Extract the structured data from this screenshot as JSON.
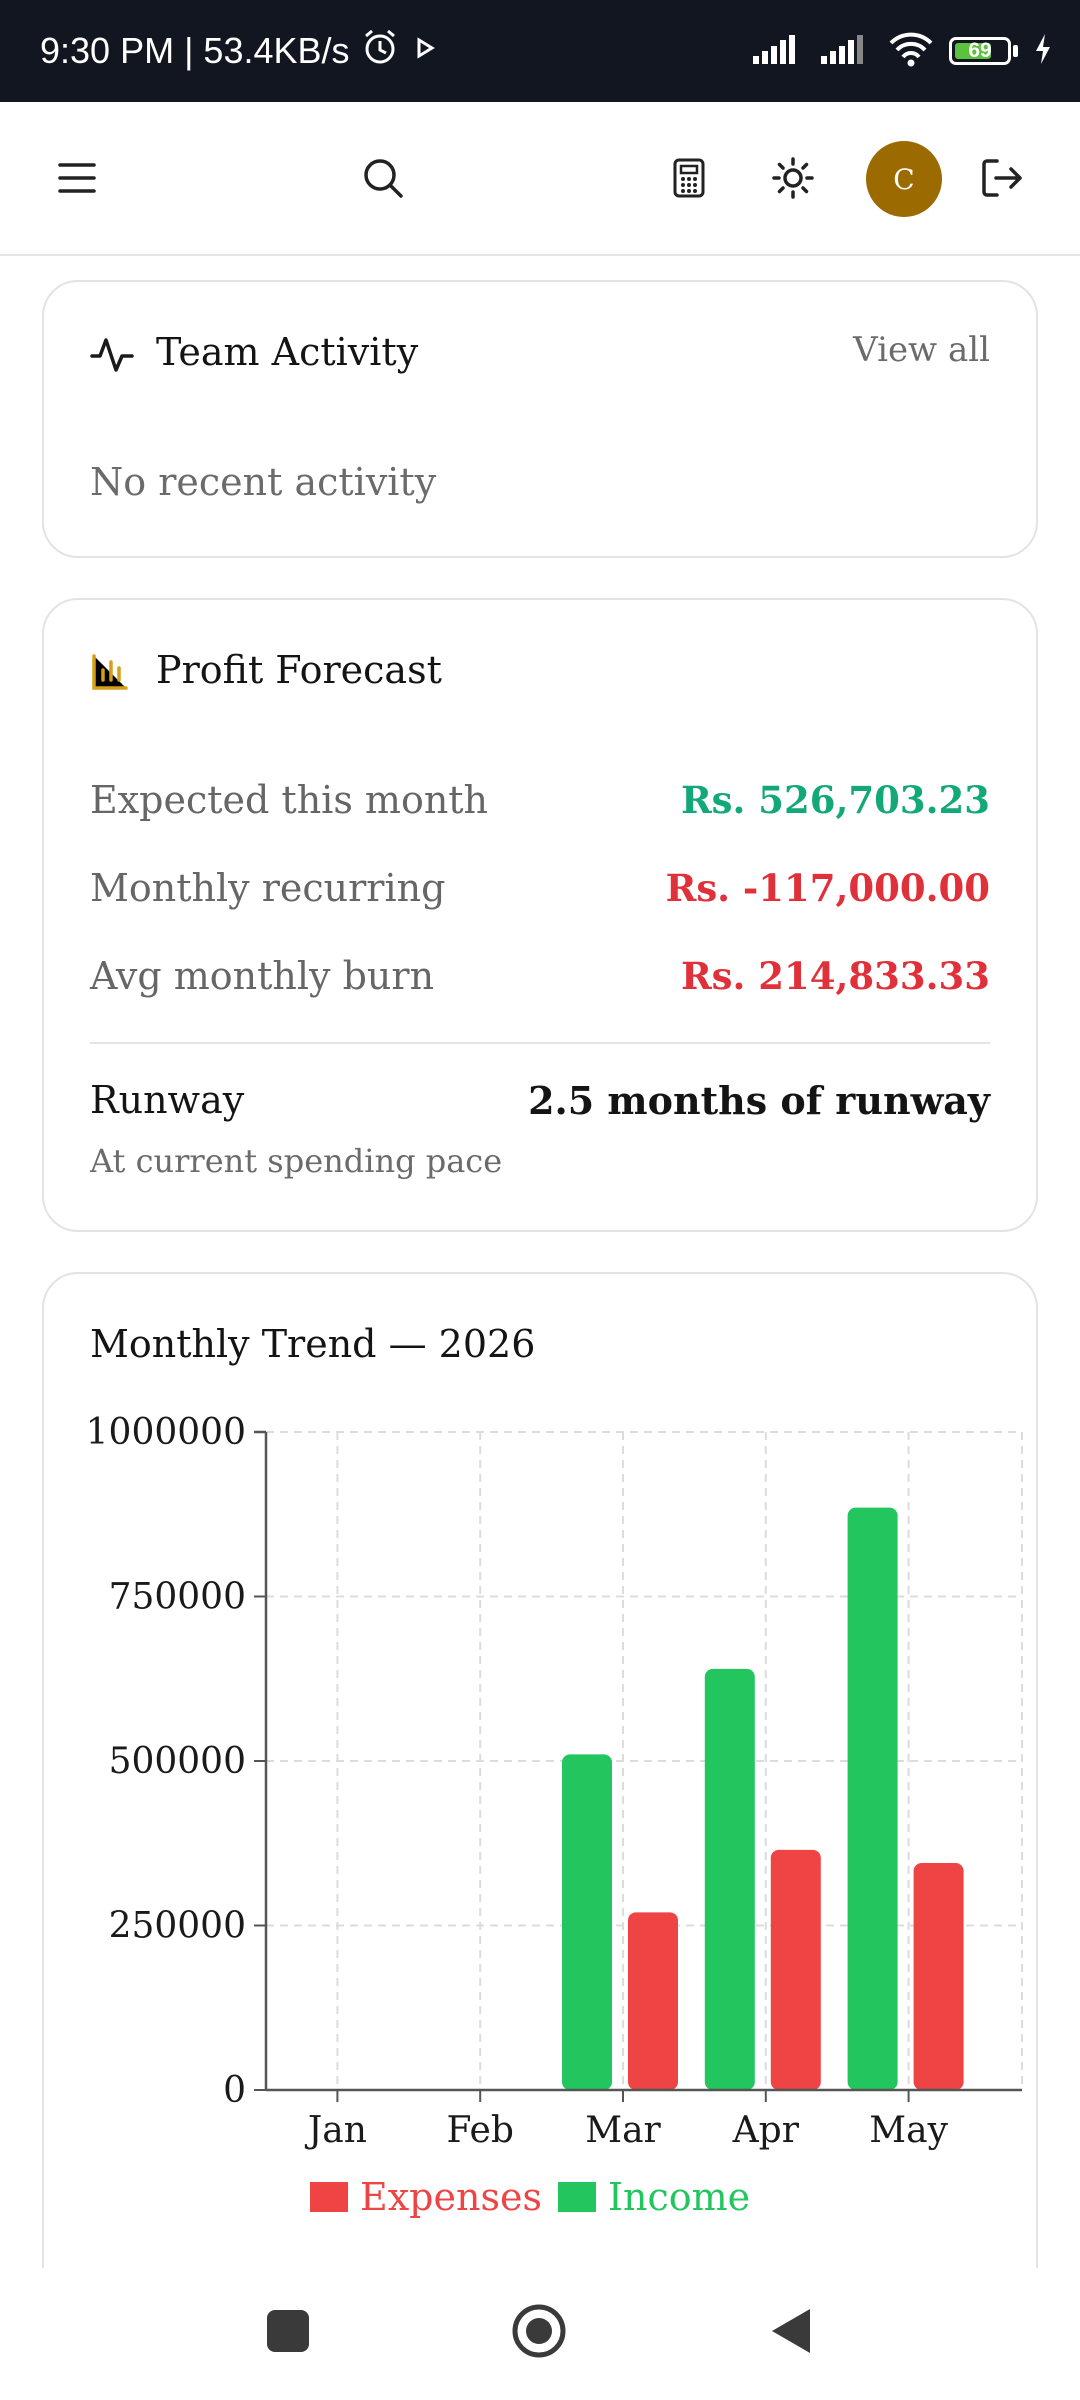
{
  "status_bar": {
    "time_speed": "9:30 PM | 53.4KB/s",
    "battery": "69"
  },
  "profile": {
    "initial": "C"
  },
  "team_activity": {
    "title": "Team Activity",
    "view_all": "View all",
    "empty_message": "No recent activity"
  },
  "profit_forecast": {
    "title": "Profit Forecast",
    "rows": [
      {
        "label": "Expected this month",
        "value": "Rs. 526,703.23",
        "tone": "positive"
      },
      {
        "label": "Monthly recurring",
        "value": "Rs. -117,000.00",
        "tone": "negative"
      },
      {
        "label": "Avg monthly burn",
        "value": "Rs. 214,833.33",
        "tone": "negative"
      }
    ],
    "runway_label": "Runway",
    "runway_value": "2.5 months of runway",
    "runway_note": "At current spending pace"
  },
  "colors": {
    "income": "#22c55e",
    "expenses": "#ef4444",
    "positive": "#13a87a",
    "negative": "#e0303a",
    "avatar": "#9b6a00"
  },
  "icons": [
    "menu-icon",
    "search-icon",
    "calculator-icon",
    "sun-icon",
    "logout-icon",
    "activity-icon",
    "bar-chart-icon",
    "battery-icon",
    "wifi-icon",
    "signal-icon",
    "alarm-icon"
  ],
  "chart_data": {
    "type": "bar",
    "title": "Monthly Trend — 2026",
    "categories": [
      "Jan",
      "Feb",
      "Mar",
      "Apr",
      "May"
    ],
    "series": [
      {
        "name": "Income",
        "values": [
          0,
          0,
          510000,
          640000,
          885000
        ]
      },
      {
        "name": "Expenses",
        "values": [
          0,
          0,
          270000,
          365000,
          345000
        ]
      }
    ],
    "yticks": [
      0,
      250000,
      500000,
      750000,
      1000000
    ],
    "ylim": [
      0,
      1000000
    ],
    "grid": true,
    "legend": [
      "Expenses",
      "Income"
    ],
    "legend_position": "bottom"
  }
}
